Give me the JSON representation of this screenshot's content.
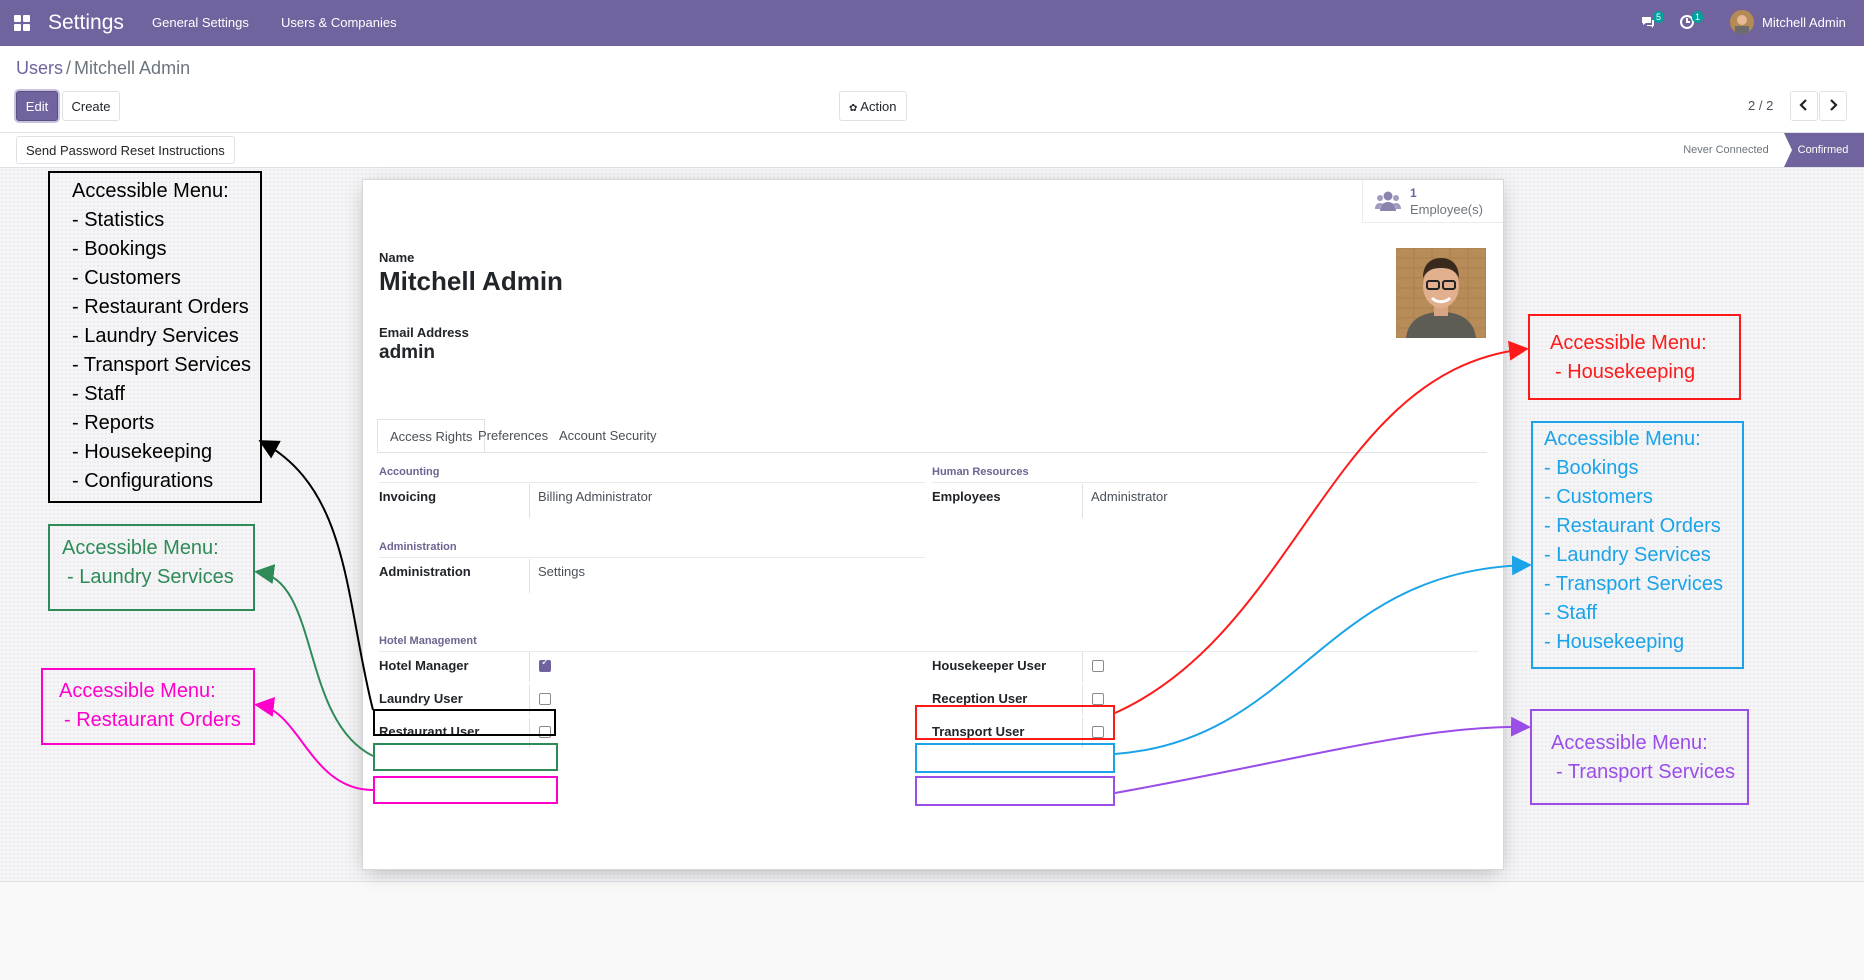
{
  "topbar": {
    "app_title": "Settings",
    "menus": [
      "General Settings",
      "Users & Companies"
    ],
    "messages_count": "5",
    "activities_count": "1",
    "user_name": "Mitchell Admin",
    "color": "#71639e"
  },
  "breadcrumb": {
    "parent": "Users",
    "separator": "/",
    "current": "Mitchell Admin"
  },
  "buttons": {
    "edit": "Edit",
    "create": "Create",
    "action": "Action"
  },
  "pager": {
    "value": "2 / 2"
  },
  "status": {
    "reset_button": "Send Password Reset Instructions",
    "stages": [
      "Never Connected",
      "Confirmed"
    ],
    "current": "Confirmed"
  },
  "smart_button": {
    "count": "1",
    "label": "Employee(s)"
  },
  "form": {
    "name_label": "Name",
    "name": "Mitchell Admin",
    "email_label": "Email Address",
    "email": "admin"
  },
  "tabs": [
    "Access Rights",
    "Preferences",
    "Account Security"
  ],
  "access": {
    "accounting": {
      "title": "Accounting",
      "field": "Invoicing",
      "value": "Billing Administrator"
    },
    "hr": {
      "title": "Human Resources",
      "field": "Employees",
      "value": "Administrator"
    },
    "administration": {
      "title": "Administration",
      "field": "Administration",
      "value": "Settings"
    },
    "hotel": {
      "title": "Hotel Management",
      "left": [
        {
          "label": "Hotel Manager",
          "checked": true
        },
        {
          "label": "Laundry User",
          "checked": false
        },
        {
          "label": "Restaurant User",
          "checked": false
        }
      ],
      "right": [
        {
          "label": "Housekeeper User",
          "checked": false
        },
        {
          "label": "Reception User",
          "checked": false
        },
        {
          "label": "Transport User",
          "checked": false
        }
      ]
    }
  },
  "annotations": {
    "manager": {
      "color": "#000000",
      "lines": [
        "Accessible Menu:",
        "- Statistics",
        "- Bookings",
        "- Customers",
        "- Restaurant Orders",
        "- Laundry Services",
        "- Transport Services",
        "- Staff",
        "- Reports",
        "- Housekeeping",
        "- Configurations"
      ]
    },
    "laundry": {
      "color": "#2e8b57",
      "lines": [
        "Accessible Menu:",
        " - Laundry Services"
      ]
    },
    "restaurant": {
      "color": "#ff00cc",
      "lines": [
        "Accessible Menu:",
        " - Restaurant Orders"
      ]
    },
    "housekeeping": {
      "color": "#ff1a1a",
      "lines": [
        "Accessible Menu:",
        " - Housekeeping"
      ]
    },
    "reception": {
      "color": "#1aa3e8",
      "lines": [
        "Accessible Menu:",
        "- Bookings",
        "- Customers",
        "- Restaurant Orders",
        "- Laundry Services",
        "- Transport Services",
        "- Staff",
        "- Housekeeping"
      ]
    },
    "transport": {
      "color": "#9b4de8",
      "lines": [
        "Accessible Menu:",
        " - Transport Services"
      ]
    }
  }
}
